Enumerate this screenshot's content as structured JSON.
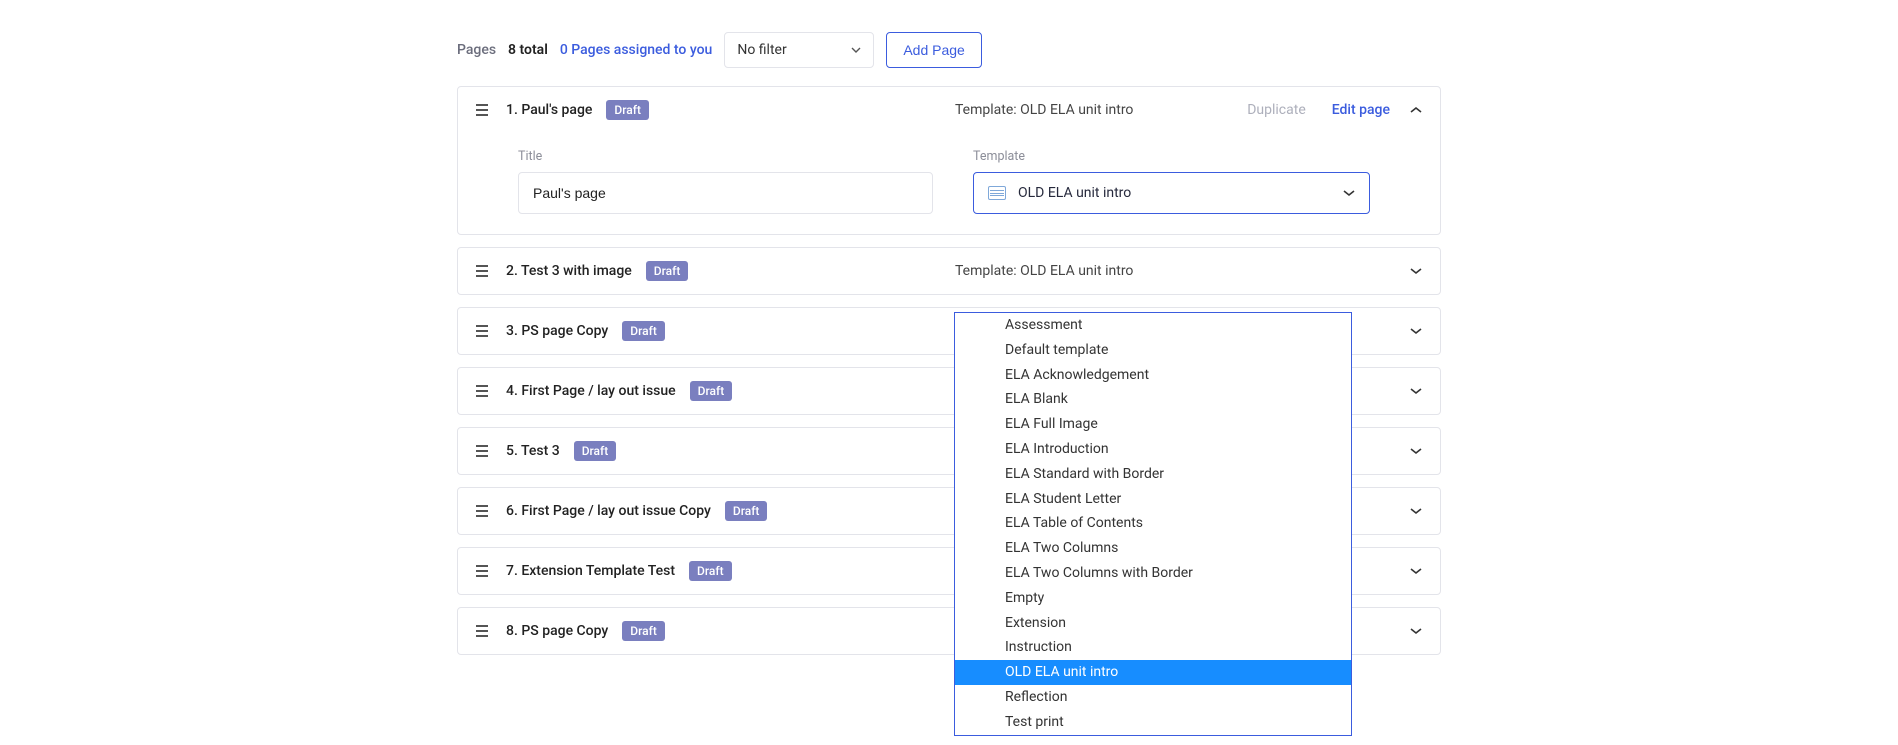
{
  "header": {
    "label": "Pages",
    "total": "8 total",
    "assigned": "0 Pages assigned to you",
    "filter": "No filter",
    "add": "Add Page"
  },
  "expanded": {
    "titleLabel": "Title",
    "titleValue": "Paul's page",
    "templateLabel": "Template",
    "templateValue": "OLD ELA unit intro",
    "duplicate": "Duplicate",
    "edit": "Edit page"
  },
  "rows": [
    {
      "num": "1.",
      "title": "Paul's page",
      "badge": "Draft",
      "template": "Template: OLD ELA unit intro"
    },
    {
      "num": "2.",
      "title": "Test 3 with image",
      "badge": "Draft",
      "template": "Template: OLD ELA unit intro"
    },
    {
      "num": "3.",
      "title": "PS page Copy",
      "badge": "Draft",
      "template": ""
    },
    {
      "num": "4.",
      "title": "First Page / lay out issue",
      "badge": "Draft",
      "template": ""
    },
    {
      "num": "5.",
      "title": "Test 3",
      "badge": "Draft",
      "template": ""
    },
    {
      "num": "6.",
      "title": "First Page / lay out issue Copy",
      "badge": "Draft",
      "template": ""
    },
    {
      "num": "7.",
      "title": "Extension Template Test",
      "badge": "Draft",
      "template": ""
    },
    {
      "num": "8.",
      "title": "PS page Copy",
      "badge": "Draft",
      "template": ""
    }
  ],
  "dropdown": {
    "selected": "OLD ELA unit intro",
    "options": [
      "Assessment",
      "Default template",
      "ELA Acknowledgement",
      "ELA Blank",
      "ELA Full Image",
      "ELA Introduction",
      "ELA Standard with Border",
      "ELA Student Letter",
      "ELA Table of Contents",
      "ELA Two Columns",
      "ELA Two Columns with Border",
      "Empty",
      "Extension",
      "Instruction",
      "OLD ELA unit intro",
      "Reflection",
      "Test print"
    ]
  }
}
